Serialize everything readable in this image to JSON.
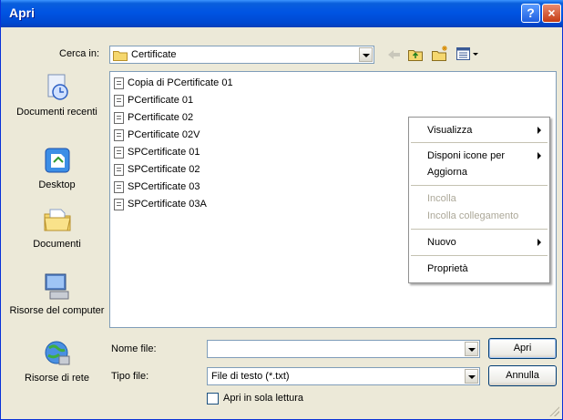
{
  "window": {
    "title": "Apri",
    "help_glyph": "?",
    "close_glyph": "×"
  },
  "lookin": {
    "label": "Cerca in:",
    "value": "Certificate"
  },
  "places": [
    {
      "label": "Documenti recenti",
      "icon": "recent-documents-icon"
    },
    {
      "label": "Desktop",
      "icon": "desktop-icon"
    },
    {
      "label": "Documenti",
      "icon": "my-documents-icon"
    },
    {
      "label": "Risorse del computer",
      "icon": "my-computer-icon"
    },
    {
      "label": "Risorse di rete",
      "icon": "network-places-icon"
    }
  ],
  "files": [
    "Copia di PCertificate 01",
    "PCertificate 01",
    "PCertificate 02",
    "PCertificate 02V",
    "SPCertificate 01",
    "SPCertificate 02",
    "SPCertificate 03",
    "SPCertificate 03A"
  ],
  "context_menu": {
    "visualizza": "Visualizza",
    "disponi": "Disponi icone per",
    "aggiorna": "Aggiorna",
    "incolla": "Incolla",
    "incolla_collegamento": "Incolla collegamento",
    "nuovo": "Nuovo",
    "proprieta": "Proprietà"
  },
  "filename": {
    "label": "Nome file:",
    "value": ""
  },
  "filetype": {
    "label": "Tipo file:",
    "value": "File di testo (*.txt)"
  },
  "buttons": {
    "open": "Apri",
    "cancel": "Annulla"
  },
  "readonly": {
    "label": "Apri in sola lettura",
    "checked": false
  },
  "colors": {
    "title_bar": "#0054e3",
    "dialog_bg": "#ece9d8",
    "disabled_text": "#aca899"
  }
}
